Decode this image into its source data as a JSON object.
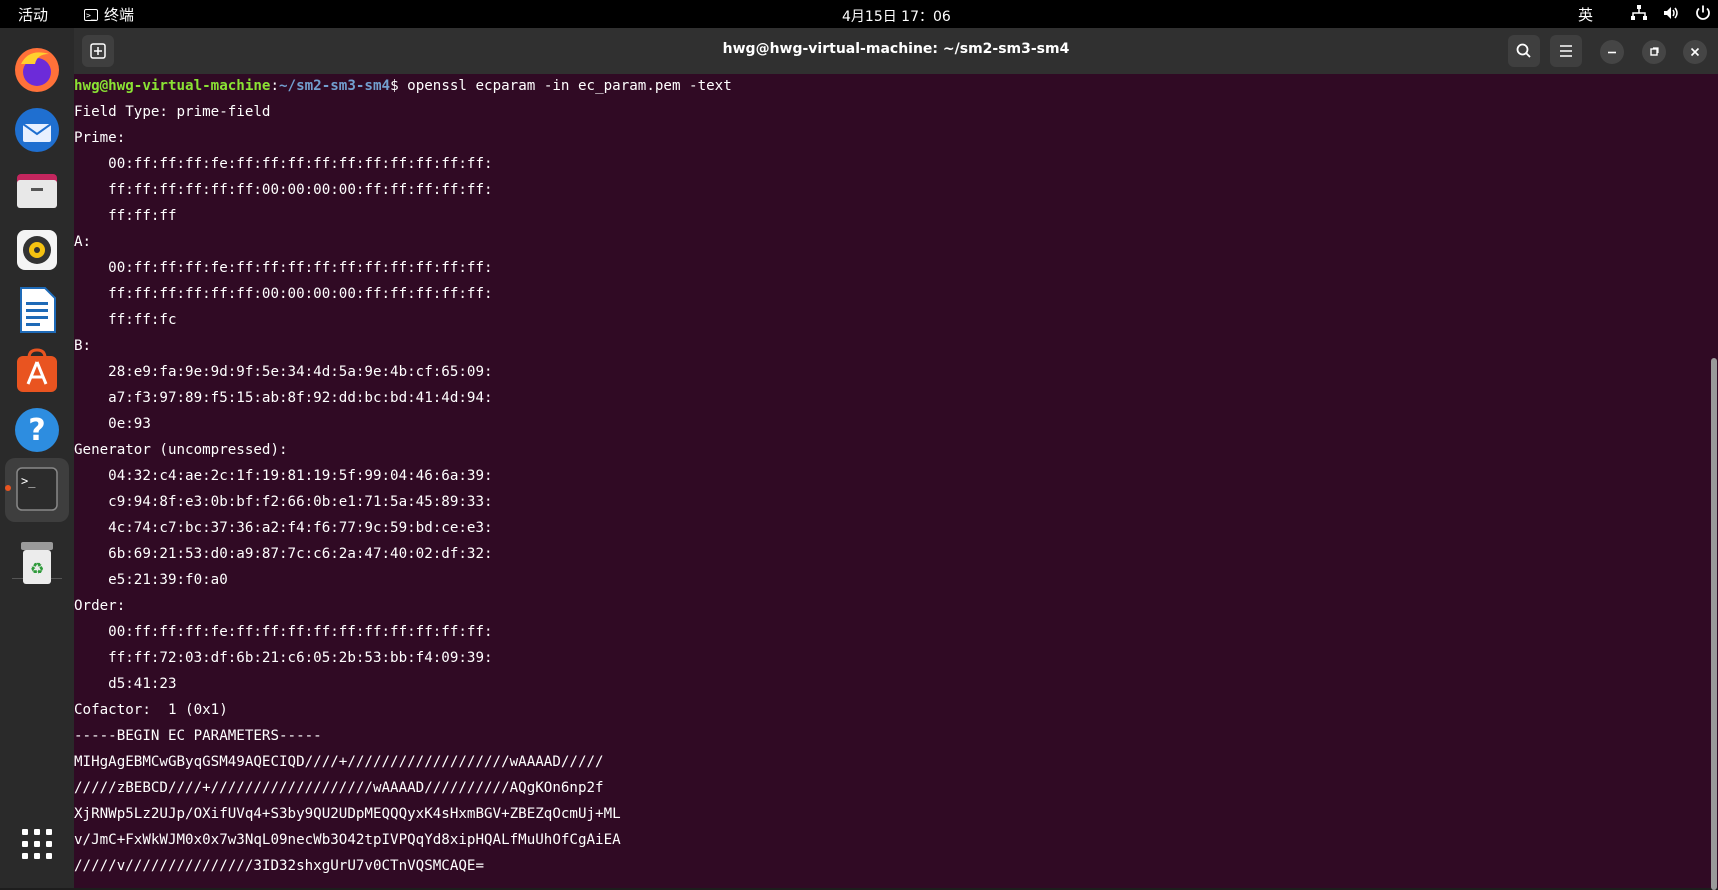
{
  "topbar": {
    "activities": "活动",
    "app_name": "终端",
    "clock": "4月15日  17：06",
    "input_method": "英"
  },
  "window": {
    "title": "hwg@hwg-virtual-machine: ~/sm2-sm3-sm4"
  },
  "terminal": {
    "prompt_user": "hwg@hwg-virtual-machine",
    "prompt_sep": ":",
    "prompt_path": "~/sm2-sm3-sm4",
    "prompt_end": "$ ",
    "command": "openssl ecparam -in ec_param.pem -text",
    "lines": [
      "Field Type: prime-field",
      "Prime:",
      "    00:ff:ff:ff:fe:ff:ff:ff:ff:ff:ff:ff:ff:ff:ff:",
      "    ff:ff:ff:ff:ff:ff:00:00:00:00:ff:ff:ff:ff:ff:",
      "    ff:ff:ff",
      "A:",
      "    00:ff:ff:ff:fe:ff:ff:ff:ff:ff:ff:ff:ff:ff:ff:",
      "    ff:ff:ff:ff:ff:ff:00:00:00:00:ff:ff:ff:ff:ff:",
      "    ff:ff:fc",
      "B:",
      "    28:e9:fa:9e:9d:9f:5e:34:4d:5a:9e:4b:cf:65:09:",
      "    a7:f3:97:89:f5:15:ab:8f:92:dd:bc:bd:41:4d:94:",
      "    0e:93",
      "Generator (uncompressed):",
      "    04:32:c4:ae:2c:1f:19:81:19:5f:99:04:46:6a:39:",
      "    c9:94:8f:e3:0b:bf:f2:66:0b:e1:71:5a:45:89:33:",
      "    4c:74:c7:bc:37:36:a2:f4:f6:77:9c:59:bd:ce:e3:",
      "    6b:69:21:53:d0:a9:87:7c:c6:2a:47:40:02:df:32:",
      "    e5:21:39:f0:a0",
      "Order:",
      "    00:ff:ff:ff:fe:ff:ff:ff:ff:ff:ff:ff:ff:ff:ff:",
      "    ff:ff:72:03:df:6b:21:c6:05:2b:53:bb:f4:09:39:",
      "    d5:41:23",
      "Cofactor:  1 (0x1)",
      "-----BEGIN EC PARAMETERS-----",
      "MIHgAgEBMCwGByqGSM49AQECIQD////+///////////////////wAAAAD/////",
      "/////zBEBCD////+///////////////////wAAAAD//////////AQgKOn6np2f",
      "XjRNWp5Lz2UJp/OXifUVq4+S3by9QU2UDpMEQQQyxK4sHxmBGV+ZBEZqOcmUj+ML",
      "v/JmC+FxWkWJM0x0x7w3NqL09necWb3O42tpIVPQqYd8xipHQALfMuUhOfCgAiEA",
      "/////v///////////////3ID32shxgUrU7v0CTnVQSMCAQE="
    ]
  },
  "dock": {
    "items": [
      "firefox-icon",
      "thunderbird-icon",
      "files-icon",
      "rhythmbox-icon",
      "writer-icon",
      "app-center-icon",
      "help-icon",
      "terminal-icon",
      "trash-icon",
      "app-grid-icon"
    ]
  },
  "colors": {
    "terminal_bg": "#300a24",
    "prompt_user": "#8ae234",
    "prompt_path": "#729fcf",
    "accent": "#e95420"
  }
}
